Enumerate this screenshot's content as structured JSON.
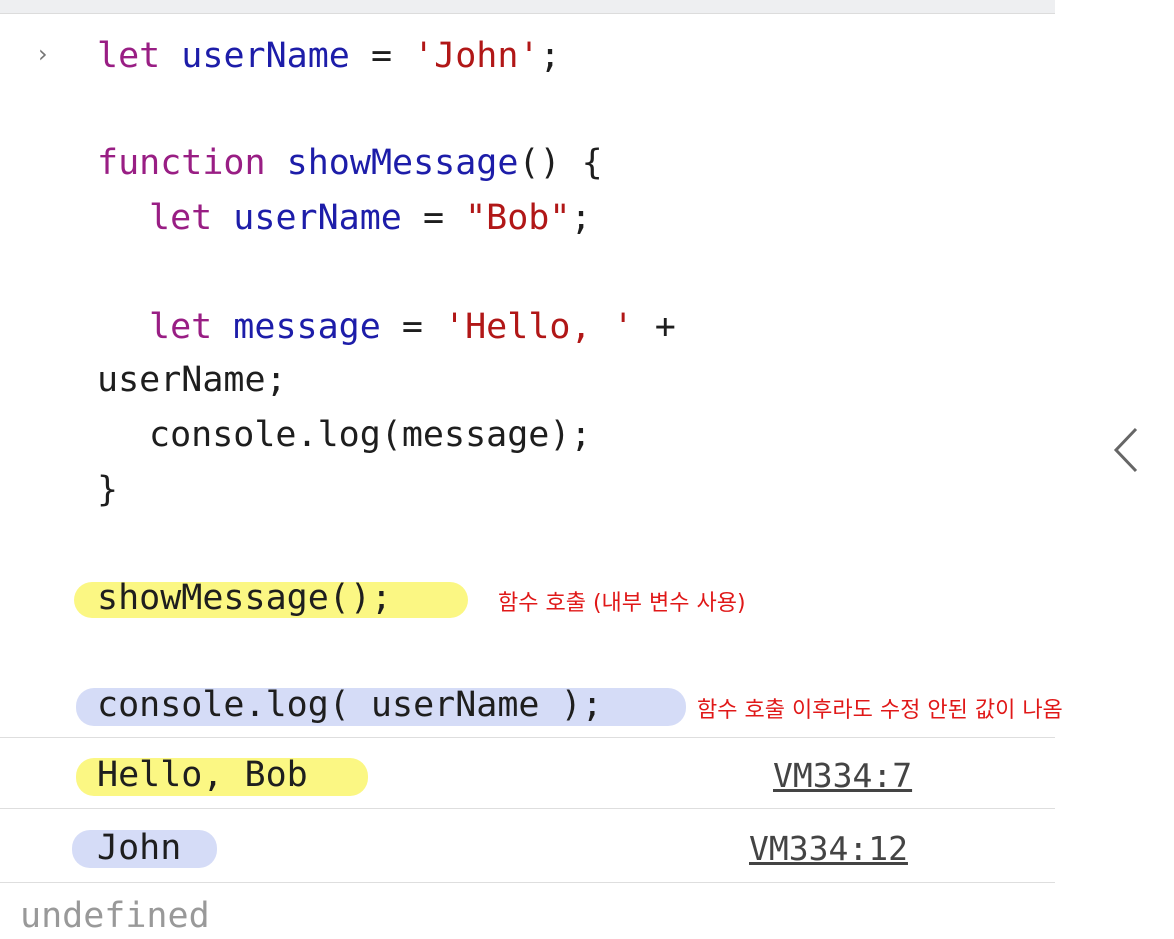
{
  "prompt_symbol": "›",
  "code": {
    "line1": {
      "kw": "let",
      "id": "userName",
      "op": " = ",
      "str": "'John'",
      "end": ";"
    },
    "line2": {
      "kw": "function",
      "id": "showMessage",
      "rest": "() {"
    },
    "line3": {
      "kw": "let",
      "id": "userName",
      "op": " = ",
      "str": "\"Bob\"",
      "end": ";"
    },
    "line4": {
      "kw": "let",
      "id": "message",
      "op": " = ",
      "str": "'Hello, '",
      "end": " +"
    },
    "line5": {
      "text": "userName;"
    },
    "line6": {
      "text": "console.log(message);"
    },
    "line7": {
      "text": "}"
    },
    "line8": {
      "text": "showMessage();"
    },
    "line9": {
      "text": "console.log( userName );"
    }
  },
  "annotations": {
    "call_note": "함수 호출 (내부 변수 사용)",
    "log_note": "함수 호출 이후라도 수정 안된 값이 나옴"
  },
  "output": [
    {
      "text": "Hello, Bob",
      "source": "VM334:7"
    },
    {
      "text": "John",
      "source": "VM334:12"
    }
  ],
  "trailing": "undefined",
  "colors": {
    "highlight_yellow": "#fbf783",
    "highlight_blue": "#d5dcf7",
    "note_red": "#e01818"
  }
}
